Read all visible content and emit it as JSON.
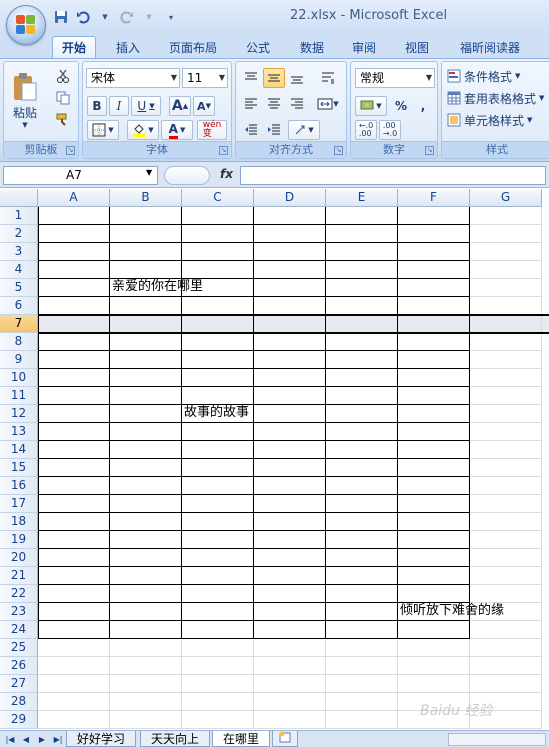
{
  "window": {
    "title": "22.xlsx - Microsoft Excel"
  },
  "quick_access": [
    "save-icon",
    "undo-icon",
    "redo-icon",
    "customize-icon"
  ],
  "tabs": [
    "开始",
    "插入",
    "页面布局",
    "公式",
    "数据",
    "审阅",
    "视图",
    "福昕阅读器"
  ],
  "active_tab": "开始",
  "ribbon": {
    "clipboard": {
      "label": "剪贴板",
      "paste": "粘贴"
    },
    "font": {
      "label": "字体",
      "name": "宋体",
      "size": "11",
      "bold": "B",
      "italic": "I",
      "underline": "U",
      "grow": "A",
      "shrink": "A",
      "font_color": "A",
      "phonetic": "wén\n变"
    },
    "alignment": {
      "label": "对齐方式"
    },
    "number": {
      "label": "数字",
      "format": "常规",
      "percent": "%",
      "comma": ","
    },
    "styles": {
      "label": "样式",
      "conditional": "条件格式",
      "table": "套用表格格式",
      "cell": "单元格样式"
    }
  },
  "formula_bar": {
    "name_box": "A7",
    "fx": "fx",
    "value": ""
  },
  "columns": [
    "A",
    "B",
    "C",
    "D",
    "E",
    "F",
    "G"
  ],
  "rows": [
    "1",
    "2",
    "3",
    "4",
    "5",
    "6",
    "7",
    "8",
    "9",
    "10",
    "11",
    "12",
    "13",
    "14",
    "15",
    "16",
    "17",
    "18",
    "19",
    "20",
    "21",
    "22",
    "23",
    "24",
    "25",
    "26",
    "27",
    "28",
    "29"
  ],
  "selected_row": "7",
  "cells": [
    {
      "ref": "B5",
      "text": "亲爱的你在哪里"
    },
    {
      "ref": "C12",
      "text": "故事的故事"
    },
    {
      "ref": "F23",
      "text": "倾听放下难舍的缘"
    }
  ],
  "sheets": [
    "好好学习",
    "天天向上",
    "在哪里"
  ],
  "active_sheet": "在哪里",
  "watermark": "Baidu 经验",
  "colors": {
    "accent": "#15428b",
    "ribbon": "#d4e3f6",
    "selection": "#f5c56b"
  }
}
